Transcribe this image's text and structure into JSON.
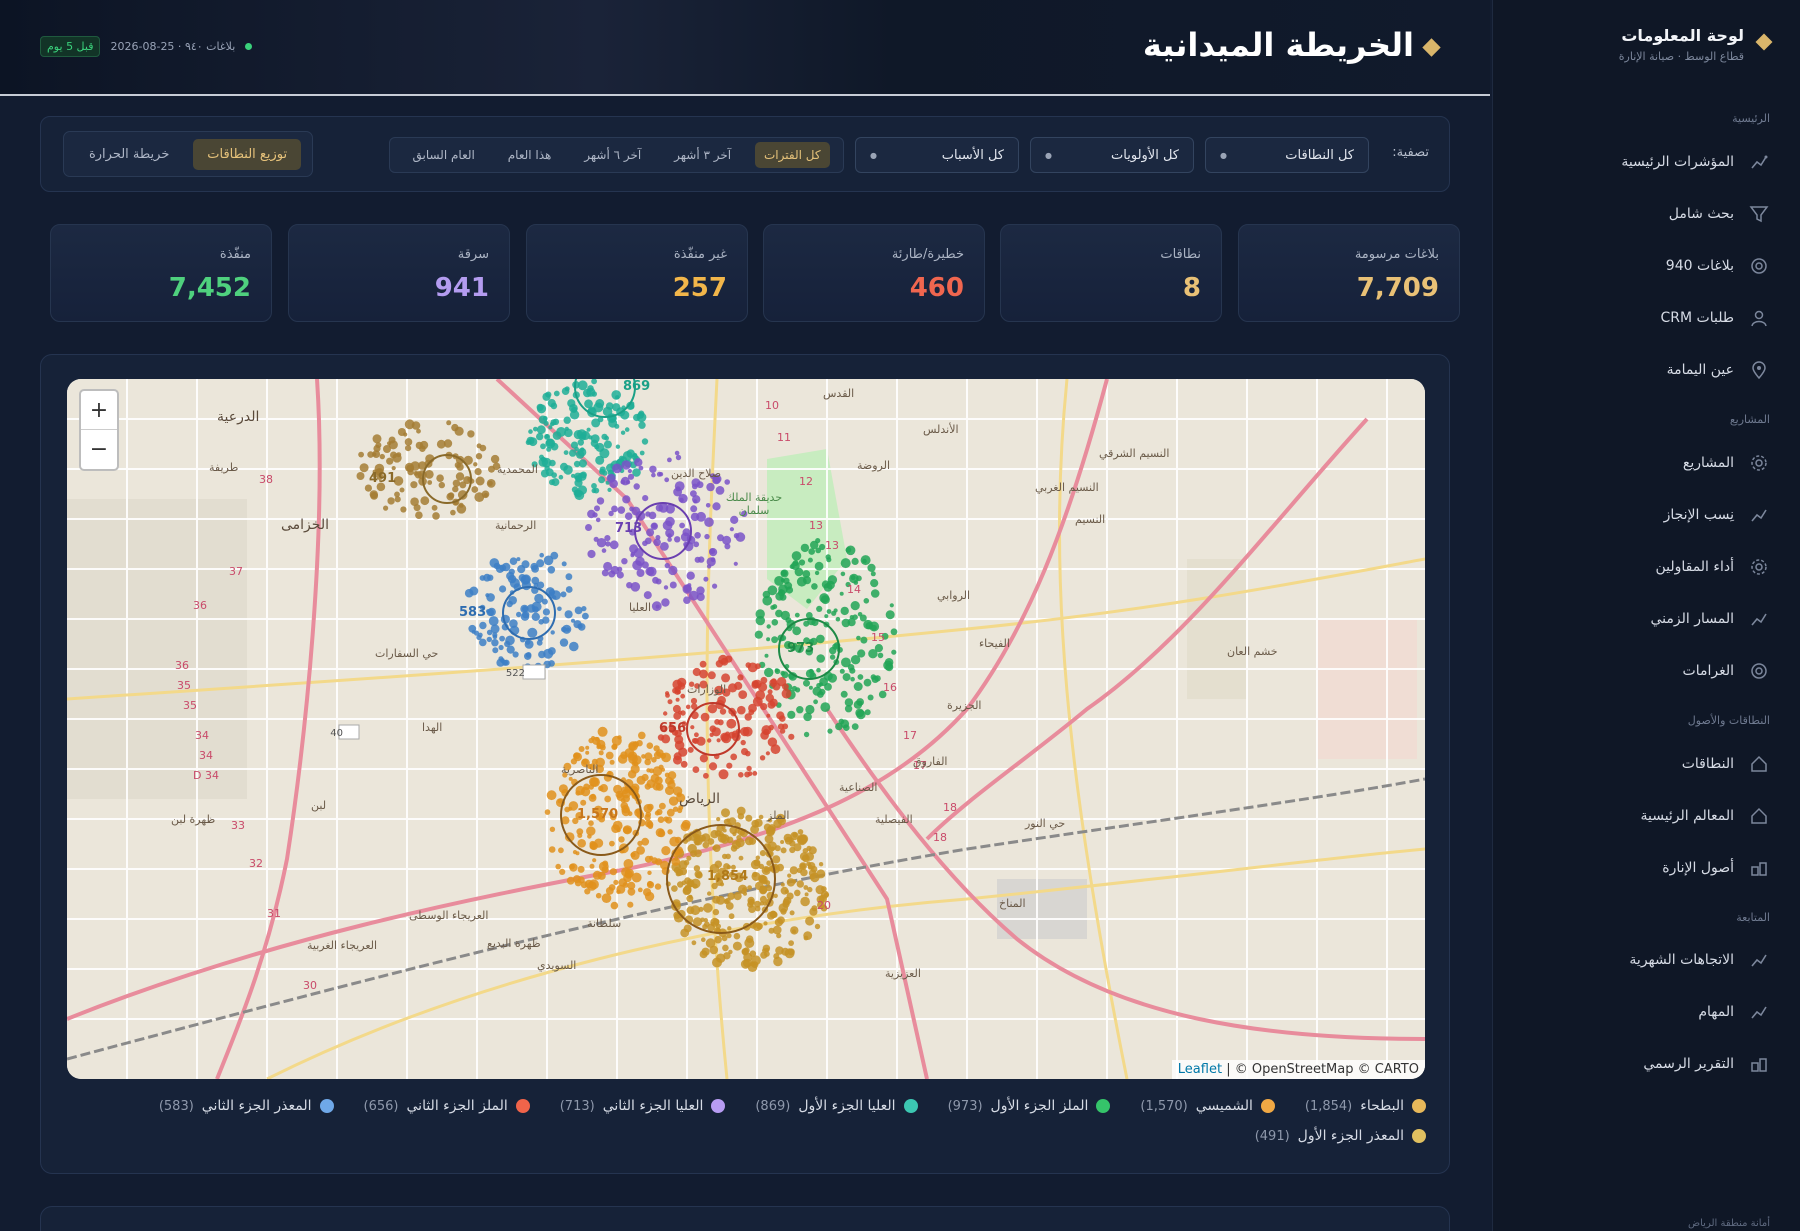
{
  "sidebar": {
    "brand_title": "لوحة المعلومات",
    "brand_subtitle": "قطاع الوسط · صيانة الإنارة",
    "sections": [
      "الرئيسية",
      "المشاريع",
      "النطاقات والأصول",
      "المتابعة"
    ],
    "items": [
      {
        "label": "المؤشرات الرئيسية",
        "icon": "chart-icon"
      },
      {
        "label": "بحث شامل",
        "icon": "filter-icon"
      },
      {
        "label": "بلاغات 940",
        "icon": "target-icon"
      },
      {
        "label": "طلبات CRM",
        "icon": "user-icon"
      },
      {
        "label": "عين اليمامة",
        "icon": "pin-icon"
      },
      {
        "label": "المشاريع",
        "icon": "gear-icon"
      },
      {
        "label": "نِسب الإنجاز",
        "icon": "chart-icon"
      },
      {
        "label": "أداء المقاولين",
        "icon": "gear-icon"
      },
      {
        "label": "المسار الزمني",
        "icon": "chart-icon"
      },
      {
        "label": "الغرامات",
        "icon": "target-icon"
      },
      {
        "label": "النطاقات",
        "icon": "home-icon"
      },
      {
        "label": "المعالم الرئيسية",
        "icon": "home-icon"
      },
      {
        "label": "أصول الإنارة",
        "icon": "assets-icon"
      },
      {
        "label": "الاتجاهات الشهرية",
        "icon": "chart-icon"
      },
      {
        "label": "المهام",
        "icon": "chart-icon"
      },
      {
        "label": "التقرير الرسمي",
        "icon": "assets-icon"
      }
    ],
    "footer": "أمانة منطقة الرياض"
  },
  "header": {
    "title": "الخريطة الميدانية",
    "meta": "بلاغات ٩٤٠ · 25-08-2026",
    "badge": "قبل 5 يوم"
  },
  "filters": {
    "label": "تصفية:",
    "scopes_value": "كل النطاقات",
    "priorities_value": "كل الأولويات",
    "causes_value": "كل الأسباب",
    "periods": [
      "كل الفترات",
      "آخر ٣ أشهر",
      "آخر ٦ أشهر",
      "هذا العام",
      "العام السابق"
    ],
    "active_period": "كل الفترات",
    "views": [
      "توزيع النطاقات",
      "خريطة الحرارة"
    ],
    "active_view": "توزيع النطاقات"
  },
  "kpis": [
    {
      "label": "بلاغات مرسومة",
      "value": "7,709",
      "color": "#e9c176"
    },
    {
      "label": "نطاقات",
      "value": "8",
      "color": "#e9c176"
    },
    {
      "label": "خطيرة/طارئة",
      "value": "460",
      "color": "#f0664f"
    },
    {
      "label": "غير منفّذة",
      "value": "257",
      "color": "#f2b64a"
    },
    {
      "label": "سرقة",
      "value": "941",
      "color": "#b49cf0"
    },
    {
      "label": "منفّذة",
      "value": "7,452",
      "color": "#4fd17e"
    }
  ],
  "map": {
    "attribution_leaflet": "Leaflet",
    "attribution_rest": "| © OpenStreetMap © CARTO",
    "zoom_in": "+",
    "zoom_out": "−",
    "district_labels": [
      "الدرعية",
      "طريفة",
      "الخزامى",
      "حي السفارات",
      "الهدا",
      "لبن",
      "ظهرة لبن",
      "العريجاء الوسطى",
      "العريجاء الغربية",
      "ظهرة البديع",
      "السويدي",
      "سلطانة",
      "الناصرية",
      "الملز",
      "الروضة",
      "الأندلس",
      "النسيم الشرقي",
      "النسيم الغربي",
      "النسيم",
      "الروابي",
      "الفيحاء",
      "خشم العان",
      "الجزيرة",
      "الفاروق",
      "حي النور",
      "المناخ",
      "العزيزية",
      "الصناعية",
      "الفيصلية",
      "القدس",
      "صلاح الدين",
      "حديقة الملك سلمان",
      "المحمدية",
      "الرحمانية",
      "العليا",
      "الوزارات",
      "الرياض"
    ],
    "cluster_labels": [
      {
        "text": "1,854",
        "color": "#b07a1a"
      },
      {
        "text": "1,570",
        "color": "#c8771c"
      },
      {
        "text": "973",
        "color": "#1d8a46"
      },
      {
        "text": "869",
        "color": "#1aa087"
      },
      {
        "text": "713",
        "color": "#6a3fb0"
      },
      {
        "text": "656",
        "color": "#c0392b"
      },
      {
        "text": "583",
        "color": "#2f6db0"
      },
      {
        "text": "491",
        "color": "#8a6a2a"
      }
    ]
  },
  "legend": [
    {
      "name": "البطحاء",
      "count": "(1,854)",
      "color": "#e7b85a"
    },
    {
      "name": "الشميسي",
      "count": "(1,570)",
      "color": "#f0a844"
    },
    {
      "name": "الملز الجزء الأول",
      "count": "(973)",
      "color": "#35c46a"
    },
    {
      "name": "العليا الجزء الأول",
      "count": "(869)",
      "color": "#3cc7b2"
    },
    {
      "name": "العليا الجزء الثاني",
      "count": "(713)",
      "color": "#b79cf2"
    },
    {
      "name": "الملز الجزء الثاني",
      "count": "(656)",
      "color": "#f0644a"
    },
    {
      "name": "المعذر الجزء الثاني",
      "count": "(583)",
      "color": "#6fa8e8"
    },
    {
      "name": "المعذر الجزء الأول",
      "count": "(491)",
      "color": "#e0c060"
    }
  ]
}
